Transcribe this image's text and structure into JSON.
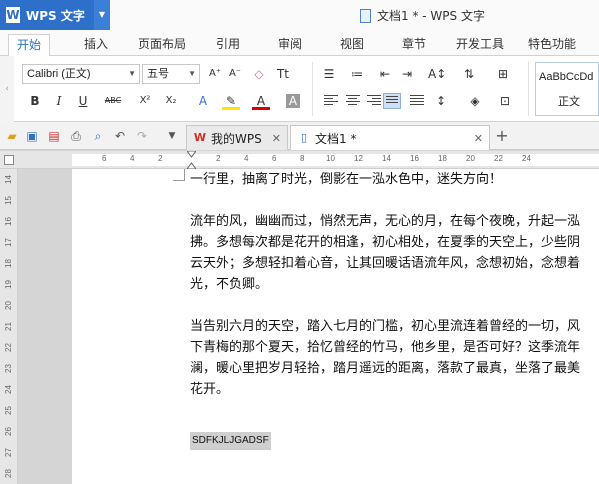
{
  "app": {
    "name": "WPS 文字",
    "window_title": "文档1 * - WPS 文字"
  },
  "menu": {
    "tabs": [
      {
        "label": "开始",
        "active": true
      },
      {
        "label": "插入"
      },
      {
        "label": "页面布局"
      },
      {
        "label": "引用"
      },
      {
        "label": "审阅"
      },
      {
        "label": "视图"
      },
      {
        "label": "章节"
      },
      {
        "label": "开发工具"
      },
      {
        "label": "特色功能"
      }
    ]
  },
  "ribbon": {
    "font_name": "Calibri (正文)",
    "font_size": "五号",
    "style_sample": "AaBbCcDd",
    "style_name": "正文",
    "buttons": {
      "bold": "B",
      "italic": "I",
      "underline": "U",
      "strike": "ABC",
      "superscript": "X²",
      "subscript": "X₂",
      "grow_font": "A⁺",
      "shrink_font": "A⁻",
      "text_effect": "A",
      "font_color": "A",
      "char_shading": "A",
      "spacing": "Tt"
    }
  },
  "quickbar": {
    "doc_tabs": [
      {
        "label": "我的WPS",
        "logo": "W",
        "active": false
      },
      {
        "label": "文档1 *",
        "active": true
      }
    ],
    "new_tab": "+"
  },
  "rulers": {
    "h_ticks": [
      "6",
      "4",
      "2",
      "2",
      "4",
      "6",
      "8",
      "10",
      "12",
      "14",
      "16",
      "18",
      "20",
      "22",
      "24"
    ],
    "v_ticks": [
      "14",
      "15",
      "16",
      "17",
      "18",
      "19",
      "20",
      "21",
      "22",
      "23",
      "24",
      "25",
      "26",
      "27",
      "28"
    ]
  },
  "document": {
    "paragraphs": [
      [
        "一行里，抽离了时光，倒影在一泓水色中，迷失方向！"
      ],
      [
        "流年的风，幽幽而过，悄然无声，无心的月，在每个夜晚，升起一泓",
        "拂。多想每次都是花开的相逢，初心相处，在夏季的天空上，少些阴",
        "云天外；多想轻扣着心音，让其回暖话语流年风，念想初始，念想着",
        "光，不负卿。"
      ],
      [
        "当告别六月的天空，踏入七月的门槛，初心里流连着曾经的一切，风",
        "下青梅的那个夏天，拾忆曾经的竹马，他乡里，是否可好？这季流年",
        "澜，暖心里把岁月轻拾，踏月遥远的距离，落款了最真，坐落了最美",
        "花开。"
      ]
    ],
    "selected_text": "SDFKJLJGADSF"
  },
  "colors": {
    "accent": "#2d6fc9",
    "tab_logo": "#d52b1e"
  }
}
